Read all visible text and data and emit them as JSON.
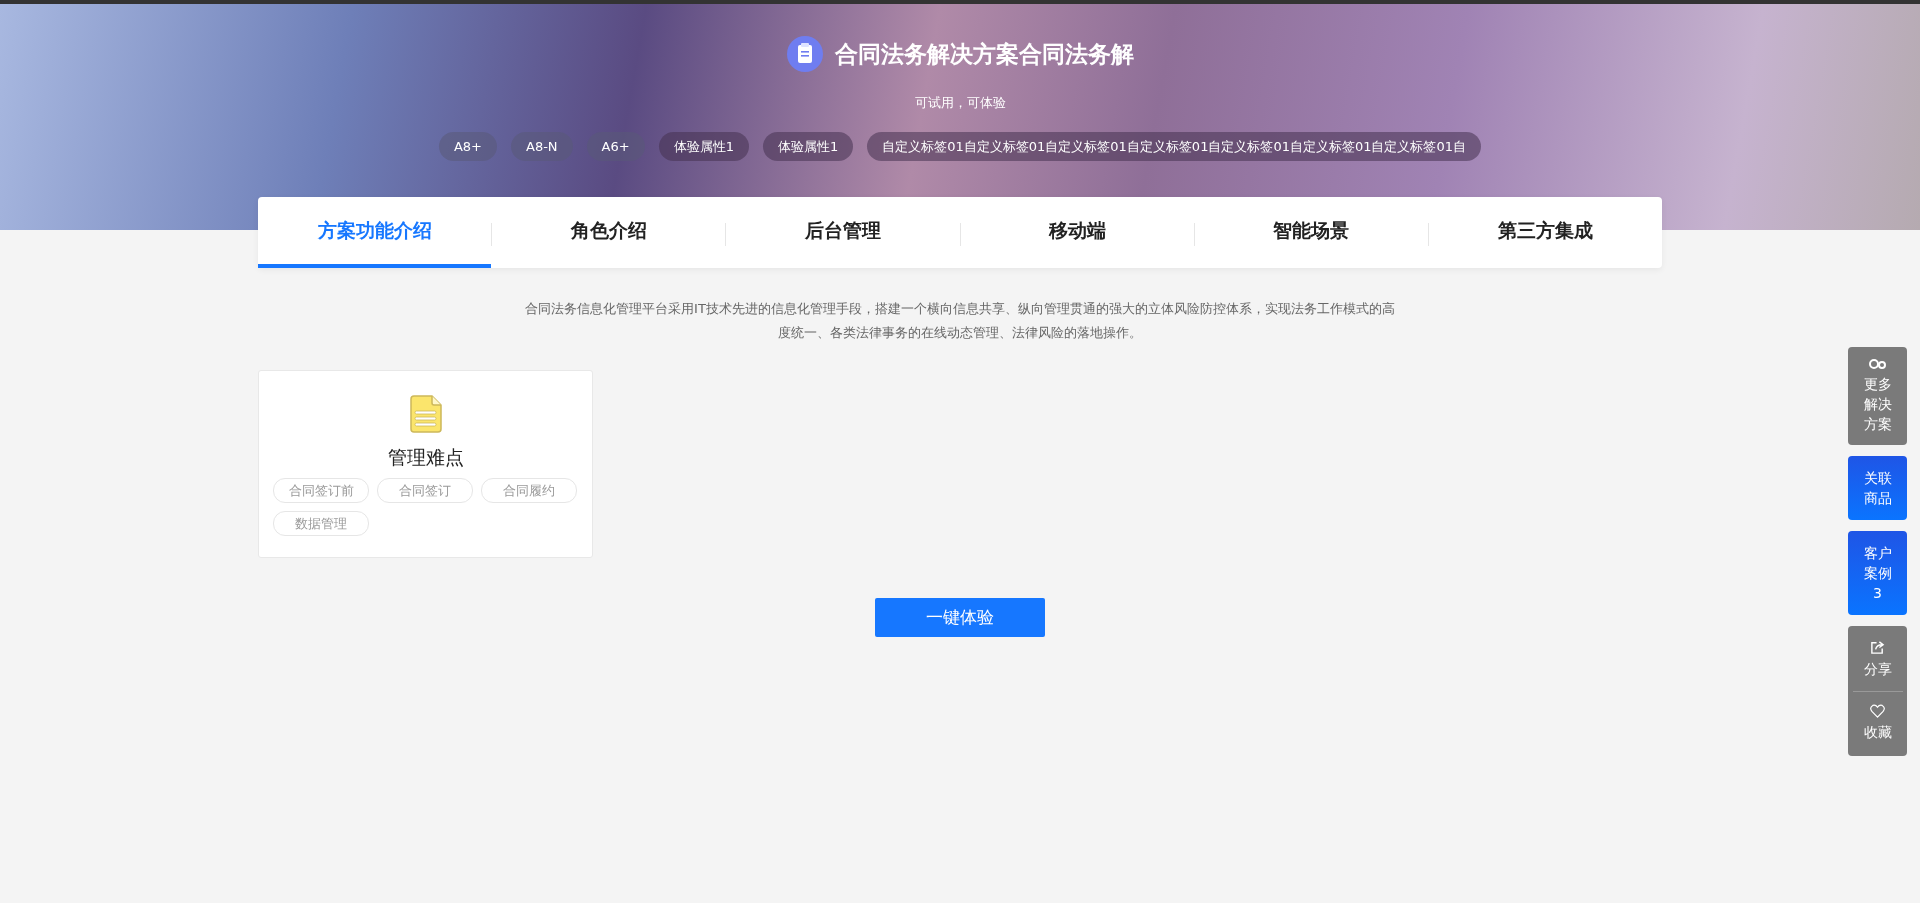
{
  "header": {
    "title": "合同法务解决方案合同法务解",
    "subtitle": "可试用，可体验",
    "tags": [
      "A8+",
      "A8-N",
      "A6+",
      "体验属性1",
      "体验属性1",
      "自定义标签01自定义标签01自定义标签01自定义标签01自定义标签01自定义标签01自定义标签01自"
    ]
  },
  "tabs": [
    {
      "label": "方案功能介绍",
      "selected": true
    },
    {
      "label": "角色介绍",
      "selected": false
    },
    {
      "label": "后台管理",
      "selected": false
    },
    {
      "label": "移动端",
      "selected": false
    },
    {
      "label": "智能场景",
      "selected": false
    },
    {
      "label": "第三方集成",
      "selected": false
    }
  ],
  "description": "合同法务信息化管理平台采用IT技术先进的信息化管理手段，搭建一个横向信息共享、纵向管理贯通的强大的立体风险防控体系，实现法务工作模式的高度统一、各类法律事务的在线动态管理、法律风险的落地操作。",
  "cards": [
    {
      "title": "管理难点",
      "tags": [
        "合同签订前",
        "合同签订",
        "合同履约",
        "数据管理"
      ]
    }
  ],
  "primary_button": "一键体验",
  "sidebar": [
    {
      "kind": "more",
      "label": "更多解决方案"
    },
    {
      "kind": "link",
      "label": "关联商品"
    },
    {
      "kind": "link",
      "label": "客户案例3"
    },
    {
      "kind": "actions",
      "items": [
        {
          "kind": "share",
          "label": "分享"
        },
        {
          "kind": "favorite",
          "label": "收藏"
        }
      ]
    }
  ]
}
